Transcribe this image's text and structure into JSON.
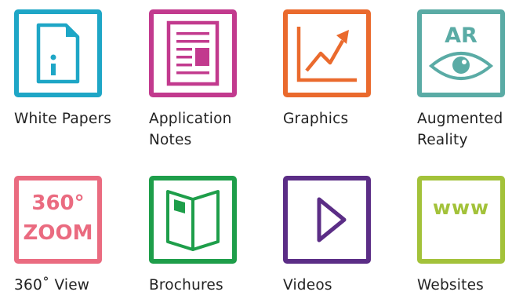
{
  "tiles": [
    {
      "label": "White Papers",
      "icon": "document-info-icon",
      "color": "#1ea6c6"
    },
    {
      "label": "Application\nNotes",
      "icon": "article-layout-icon",
      "color": "#c23a8e"
    },
    {
      "label": "Graphics",
      "icon": "line-chart-icon",
      "color": "#ea6a2d"
    },
    {
      "label": "Augmented\nReality",
      "icon": "ar-eye-icon",
      "color": "#5aaba5",
      "icon_text": "AR"
    },
    {
      "label": "360˚ View",
      "icon": "zoom-360-icon",
      "color": "#ea6b80",
      "icon_text": "360°",
      "icon_text_2": "ZOOM"
    },
    {
      "label": "Brochures",
      "icon": "open-brochure-icon",
      "color": "#1e9e4a"
    },
    {
      "label": "Videos",
      "icon": "play-icon",
      "color": "#5b2d86"
    },
    {
      "label": "Websites",
      "icon": "www-icon",
      "color": "#a3c23a",
      "icon_text": "www"
    }
  ]
}
